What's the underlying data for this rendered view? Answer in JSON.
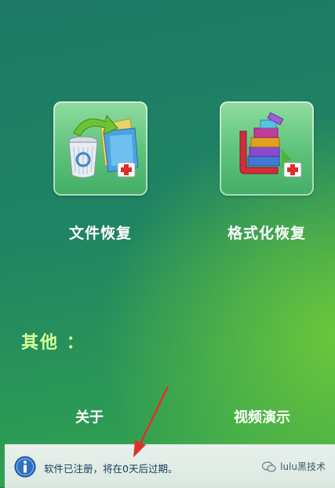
{
  "main": {
    "tiles": [
      {
        "label": "文件恢复",
        "icon": "recycle-bin-file-restore-icon"
      },
      {
        "label": "格式化恢复",
        "icon": "archive-books-restore-icon"
      }
    ],
    "other_section_title": "其他 ：",
    "links": [
      {
        "label": "关于"
      },
      {
        "label": "视频演示"
      }
    ]
  },
  "status_bar": {
    "icon": "info-icon",
    "message": "软件已注册，将在0天后过期。",
    "watermark": "lulu黑技术"
  },
  "colors": {
    "background_top": "#1e7a66",
    "background_glow": "#6cc83a",
    "section_title": "#d8ff9a",
    "status_bar": "#e8f1ec",
    "annotation_arrow": "#e0322c"
  }
}
